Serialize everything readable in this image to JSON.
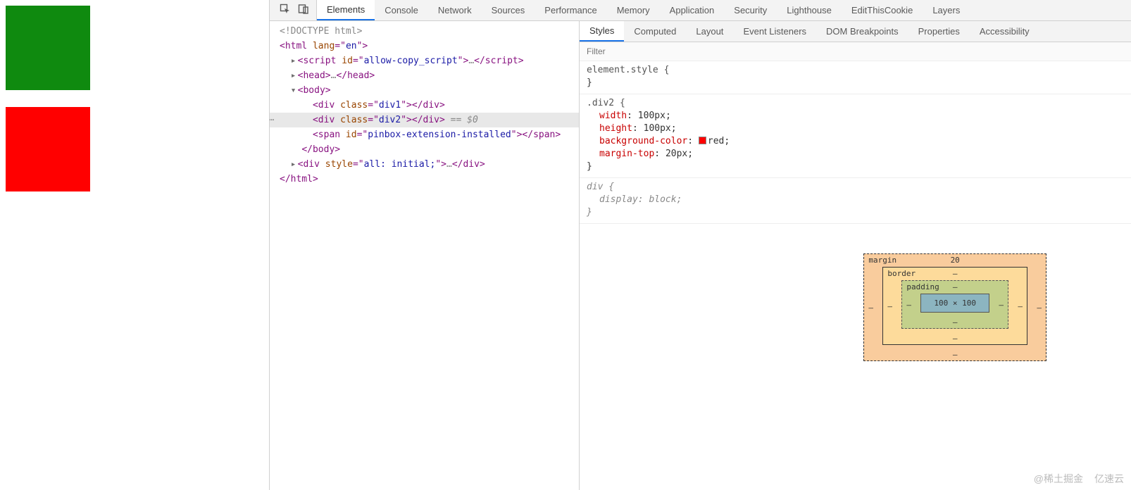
{
  "main_tabs": {
    "elements": "Elements",
    "console": "Console",
    "network": "Network",
    "sources": "Sources",
    "performance": "Performance",
    "memory": "Memory",
    "application": "Application",
    "security": "Security",
    "lighthouse": "Lighthouse",
    "editcookie": "EditThisCookie",
    "layers": "Layers"
  },
  "side_tabs": {
    "styles": "Styles",
    "computed": "Computed",
    "layout": "Layout",
    "event_listeners": "Event Listeners",
    "dom_breakpoints": "DOM Breakpoints",
    "properties": "Properties",
    "accessibility": "Accessibility"
  },
  "filter_placeholder": "Filter",
  "dom": {
    "l1": "<!DOCTYPE html>",
    "l2a": "<",
    "l2b": "html",
    "l2c": " lang",
    "l2d": "=\"",
    "l2e": "en",
    "l2f": "\">",
    "l3a": "<",
    "l3b": "script",
    "l3c": " id",
    "l3d": "=\"",
    "l3e": "allow-copy_script",
    "l3f": "\">",
    "l3g": "…",
    "l3h": "</",
    "l3i": "script",
    "l3j": ">",
    "l4a": "<",
    "l4b": "head",
    "l4c": ">",
    "l4d": "…",
    "l4e": "</",
    "l4f": "head",
    "l4g": ">",
    "l5a": "<",
    "l5b": "body",
    "l5c": ">",
    "l6a": "<",
    "l6b": "div",
    "l6c": " class",
    "l6d": "=\"",
    "l6e": "div1",
    "l6f": "\">",
    "l6g": "</",
    "l6h": "div",
    "l6i": ">",
    "l7a": "<",
    "l7b": "div",
    "l7c": " class",
    "l7d": "=\"",
    "l7e": "div2",
    "l7f": "\">",
    "l7g": "</",
    "l7h": "div",
    "l7i": ">",
    "l7j": " == $0",
    "l8a": "<",
    "l8b": "span",
    "l8c": " id",
    "l8d": "=\"",
    "l8e": "pinbox-extension-installed",
    "l8f": "\">",
    "l8g": "</",
    "l8h": "span",
    "l8i": ">",
    "l9a": "</",
    "l9b": "body",
    "l9c": ">",
    "l10a": "<",
    "l10b": "div",
    "l10c": " style",
    "l10d": "=\"",
    "l10e": "all: initial;",
    "l10f": "\">",
    "l10g": "…",
    "l10h": "</",
    "l10i": "div",
    "l10j": ">",
    "l11a": "</",
    "l11b": "html",
    "l11c": ">"
  },
  "styles": {
    "rule1_sel": "element.style {",
    "rule1_close": "}",
    "rule2_sel": ".div2 {",
    "rule2_p1n": "width",
    "rule2_p1v": "100px",
    "rule2_p2n": "height",
    "rule2_p2v": "100px",
    "rule2_p3n": "background-color",
    "rule2_p3v": "red",
    "rule2_p4n": "margin-top",
    "rule2_p4v": "20px",
    "rule2_close": "}",
    "rule3_sel": "div {",
    "rule3_p1n": "display",
    "rule3_p1v": "block",
    "rule3_close": "}"
  },
  "box_model": {
    "margin_label": "margin",
    "border_label": "border",
    "padding_label": "padding",
    "margin_top": "20",
    "dash": "–",
    "content": "100 × 100"
  },
  "watermarks": {
    "w1": "@稀土掘金",
    "w2": "亿速云"
  }
}
